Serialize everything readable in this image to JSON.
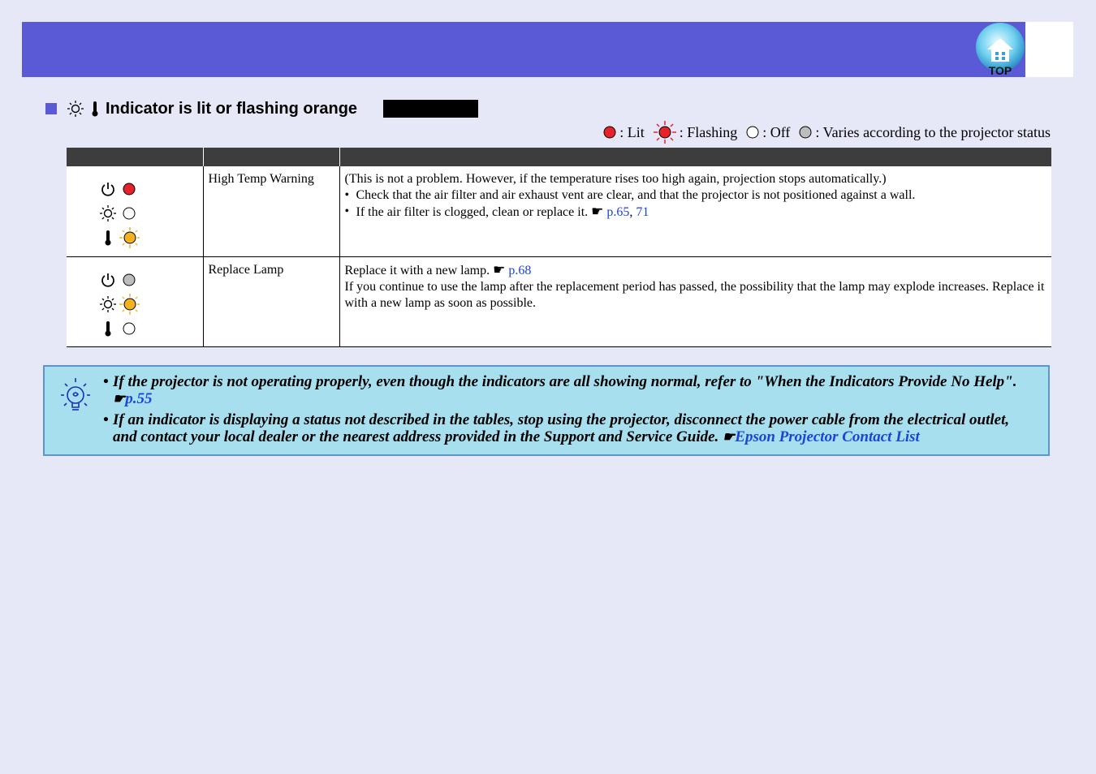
{
  "header": {
    "top_label": "TOP"
  },
  "section": {
    "title": "Indicator is lit or flashing orange"
  },
  "legend": {
    "lit": ": Lit",
    "flashing": ": Flashing",
    "off": ": Off",
    "varies": ": Varies according to the projector status"
  },
  "table": {
    "rows": [
      {
        "status": "High Temp Warning",
        "line1": "(This is not a problem. However, if the temperature rises too high again, projection stops automatically.)",
        "bullet1": "Check that the air filter and air exhaust vent are clear, and that the projector is not positioned against a wall.",
        "bullet2": "If the air filter is clogged, clean or replace it.",
        "link1": "p.65",
        "sep": ",",
        "link2": "71",
        "indicators": {
          "power": "red-lit",
          "lamp": "off",
          "temp": "orange-flashing"
        }
      },
      {
        "status": "Replace Lamp",
        "line1": "Replace it with a new lamp.",
        "link1": "p.68",
        "line2": "If you continue to use the lamp after the replacement period has passed, the possibility that the lamp may explode increases. Replace it with a new lamp as soon as possible.",
        "indicators": {
          "power": "varies",
          "lamp": "orange-flashing",
          "temp": "off"
        }
      }
    ]
  },
  "tips": [
    {
      "text": "If the projector is not operating properly, even though the indicators are all showing normal, refer to \"When the Indicators Provide No Help\".",
      "link": "p.55"
    },
    {
      "text": "If an indicator is displaying a status not described in the tables, stop using the projector, disconnect the power cable from the electrical outlet, and contact your local dealer or the nearest address provided in the Support and Service Guide.",
      "link": "Epson Projector Contact List"
    }
  ],
  "colors": {
    "banner": "#5a5ad6",
    "background": "#e6e8f8",
    "lit_red": "#e8222a",
    "flash_orange": "#f5b21f",
    "varies_gray": "#bdbdbd",
    "link": "#1a44d8",
    "tip_bg": "#a8dfee"
  }
}
